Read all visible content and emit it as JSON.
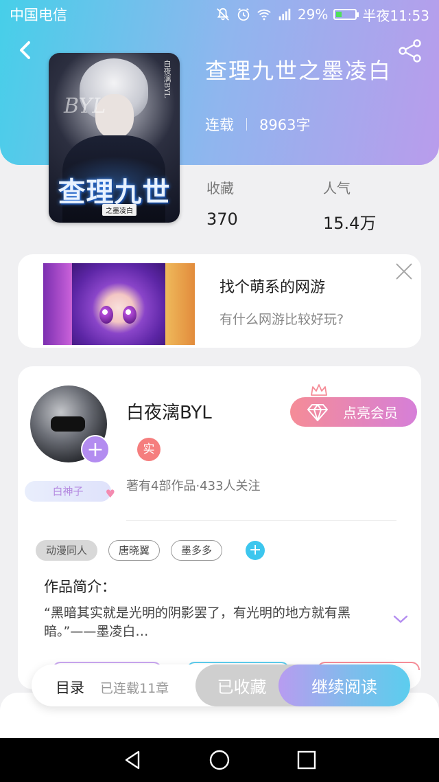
{
  "status_bar": {
    "carrier": "中国电信",
    "network": "2G",
    "battery_percent": "29%",
    "time": "半夜11:53",
    "battery_level": 0.29
  },
  "book": {
    "title": "查理九世之墨凌白",
    "status": "连载",
    "word_count": "8963字",
    "cover": {
      "title_art": "查理九世",
      "subtitle": "之墨凌白",
      "side_text": "白夜漓BYL",
      "watermark": "BYL"
    },
    "stats": [
      {
        "label": "收藏",
        "value": "370"
      },
      {
        "label": "人气",
        "value": "15.4万"
      }
    ]
  },
  "ad": {
    "title": "找个萌系的网游",
    "subtitle": "有什么网游比较好玩?"
  },
  "author": {
    "name": "白夜漓BYL",
    "real_badge": "实",
    "stats": "著有4部作品·433人关注",
    "title_badge": "白神子",
    "vip_button": "点亮会员",
    "follow": "+"
  },
  "tags": [
    "动漫同人",
    "唐晓翼",
    "墨多多"
  ],
  "tag_add": "+",
  "intro": {
    "label": "作品简介：",
    "text": "“黑暗其实就是光明的阴影罢了，有光明的地方就有黑暗。”——墨凌白…"
  },
  "bottom_bar": {
    "toc": "目录",
    "chapters": "已连载11章",
    "collected": "已收藏",
    "continue": "继续阅读"
  },
  "icons": [
    "back-icon",
    "share-icon",
    "close-icon",
    "diamond-icon",
    "crown-icon",
    "chevron-down-icon",
    "nav-back-icon",
    "nav-home-icon",
    "nav-recents-icon",
    "mute-icon",
    "alarm-icon",
    "wifi-icon",
    "signal-icon",
    "battery-icon"
  ],
  "colors": {
    "accent_purple": "#b38cf0",
    "accent_cyan": "#46cfe9",
    "vip_pink": "#f58c97"
  }
}
